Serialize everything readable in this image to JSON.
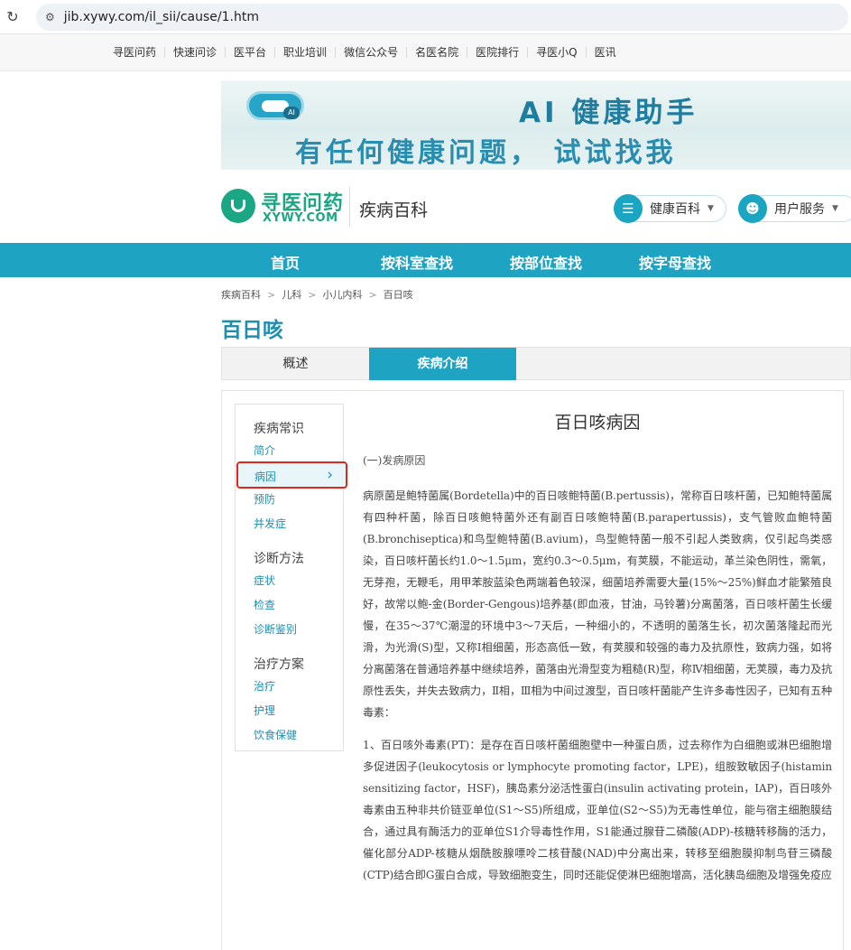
{
  "browser": {
    "url": "jib.xywy.com/il_sii/cause/1.htm"
  },
  "toplinks": [
    "寻医问药",
    "快速问诊",
    "医平台",
    "职业培训",
    "微信公众号",
    "名医名院",
    "医院排行",
    "寻医小Q",
    "医讯"
  ],
  "banner": {
    "line1": "AI 健康助手",
    "line2": "有任何健康问题， 试试找我",
    "badge": "AI"
  },
  "header": {
    "logo_cn": "寻医问药",
    "logo_en": "XYWY.COM",
    "site_name": "疾病百科",
    "health_btn": "健康百科",
    "user_btn": "用户服务",
    "accent": "#1fa3c3",
    "brand": "#1ba784"
  },
  "mainnav": [
    "首页",
    "按科室查找",
    "按部位查找",
    "按字母查找"
  ],
  "breadcrumb": [
    "疾病百科",
    "儿科",
    "小儿内科",
    "百日咳"
  ],
  "page_title": "百日咳",
  "tabs": [
    {
      "label": "概述"
    },
    {
      "label": "疾病介绍"
    }
  ],
  "sidenav": {
    "groups": [
      {
        "title": "疾病常识",
        "items": [
          "简介",
          "病因",
          "预防",
          "并发症"
        ]
      },
      {
        "title": "诊断方法",
        "items": [
          "症状",
          "检查",
          "诊断鉴别"
        ]
      },
      {
        "title": "治疗方案",
        "items": [
          "治疗",
          "护理",
          "饮食保健"
        ]
      }
    ],
    "active": "病因"
  },
  "article": {
    "title": "百日咳病因",
    "subtitle": "(一)发病原因",
    "paragraphs": [
      "病原菌是鲍特菌属(Bordetella)中的百日咳鲍特菌(B.pertussis)，常称百日咳杆菌，已知鲍特菌属有四种杆菌，除百日咳鲍特菌外还有副百日咳鲍特菌(B.parapertussis)，支气管败血鲍特菌(B.bronchiseptica)和鸟型鲍特菌(B.avium)，鸟型鲍特菌一般不引起人类致病，仅引起鸟类感染，百日咳杆菌长约1.0～1.5μm，宽约0.3～0.5μm，有荚膜，不能运动，革兰染色阴性，需氧，无芽孢，无鞭毛，用甲苯胺蓝染色两端着色较深，细菌培养需要大量(15%～25%)鲜血才能繁殖良好，故常以鲍-金(Border-Gengous)培养基(即血液，甘油，马铃薯)分离菌落，百日咳杆菌生长缓慢，在35～37℃潮湿的环境中3～7天后，一种细小的，不透明的菌落生长，初次菌落隆起而光滑，为光滑(S)型，又称I相细菌，形态高低一致，有荚膜和较强的毒力及抗原性，致病力强，如将分离菌落在普通培养基中继续培养，菌落由光滑型变为粗糙(R)型，称Ⅳ相细菌，无荚膜，毒力及抗原性丢失，并失去致病力，Ⅱ相，Ⅲ相为中间过渡型，百日咳杆菌能产生许多毒性因子，已知有五种毒素：",
      "1、百日咳外毒素(PT)：是存在百日咳杆菌细胞壁中一种蛋白质，过去称作为白细胞或淋巴细胞增多促进因子(leukocytosis or lymphocyte promoting factor，LPE)，组胺致敏因子(histamin sensitizing factor，HSF)，胰岛素分泌活性蛋白(insulin activating protein，IAP)，百日咳外毒素由五种非共价链亚单位(S1～S5)所组成，亚单位(S2～S5)为无毒性单位，能与宿主细胞膜结合，通过具有酶活力的亚单位S1介导毒性作用，S1能通过腺苷二磷酸(ADP)-核糖转移酶的活力，催化部分ADP-核糖从烟酰胺腺嘌呤二核苷酸(NAD)中分离出来，转移至细胞膜抑制鸟苷三磷酸(CTP)结合即G蛋白合成，导致细胞变生，同时还能促使淋巴细胞增高，活化胰岛细胞及增强免疫应"
    ]
  }
}
